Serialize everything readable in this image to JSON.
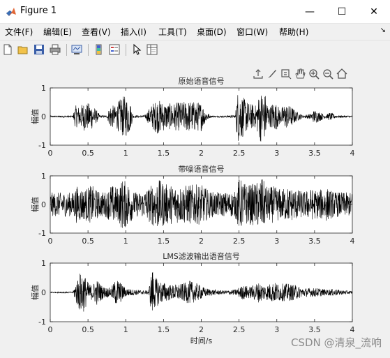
{
  "window": {
    "title": "Figure 1",
    "minimize": "—",
    "maximize": "☐",
    "close": "✕"
  },
  "menu": [
    "文件(F)",
    "编辑(E)",
    "查看(V)",
    "插入(I)",
    "工具(T)",
    "桌面(D)",
    "窗口(W)",
    "帮助(H)"
  ],
  "menu_arrow": "↘",
  "toolbar": [
    "new-figure-icon",
    "open-file-icon",
    "save-icon",
    "print-icon",
    "link-plot-icon",
    "colorbar-icon",
    "legend-icon",
    "pointer-icon",
    "property-inspector-icon"
  ],
  "axes_toolbar": [
    "export-icon",
    "brush-icon",
    "data-tip-icon",
    "pan-icon",
    "zoom-in-icon",
    "zoom-out-icon",
    "home-icon"
  ],
  "watermark": "CSDN @清泉_流响",
  "chart_data": [
    {
      "type": "line",
      "title": "原始语音信号",
      "xlabel": "",
      "ylabel": "幅值",
      "xlim": [
        0,
        4
      ],
      "ylim": [
        -1,
        1
      ],
      "xticks": [
        "0",
        "0.5",
        "1",
        "1.5",
        "2",
        "2.5",
        "3",
        "3.5",
        "4"
      ],
      "yticks": [
        "1",
        "0",
        "-1"
      ],
      "envelope": {
        "x": [
          0,
          0.3,
          0.33,
          0.38,
          0.45,
          0.55,
          0.62,
          0.66,
          0.75,
          0.8,
          0.85,
          0.88,
          0.95,
          1.0,
          1.05,
          1.1,
          1.15,
          1.25,
          1.35,
          1.42,
          1.55,
          1.7,
          1.85,
          2.0,
          2.05,
          2.12,
          2.3,
          2.45,
          2.48,
          2.52,
          2.58,
          2.65,
          2.72,
          2.78,
          2.85,
          2.9,
          2.95,
          3.0,
          3.05,
          3.1,
          3.2,
          3.25,
          3.35,
          3.45,
          3.5,
          3.65,
          3.7,
          3.8,
          4.0
        ],
        "amp": [
          0.03,
          0.03,
          0.4,
          0.35,
          0.5,
          0.45,
          0.2,
          0.04,
          0.04,
          0.45,
          0.35,
          0.45,
          0.7,
          0.72,
          0.6,
          0.04,
          0.04,
          0.04,
          0.45,
          0.6,
          0.45,
          0.5,
          0.55,
          0.5,
          0.25,
          0.03,
          0.03,
          0.05,
          0.9,
          0.85,
          0.6,
          0.45,
          0.4,
          0.9,
          0.8,
          0.3,
          0.55,
          0.45,
          0.25,
          0.45,
          0.35,
          0.2,
          0.04,
          0.1,
          0.25,
          0.05,
          0.15,
          0.04,
          0.03
        ]
      }
    },
    {
      "type": "line",
      "title": "带噪语音信号",
      "xlabel": "",
      "ylabel": "幅值",
      "xlim": [
        0,
        4
      ],
      "ylim": [
        -1,
        1
      ],
      "xticks": [
        "0",
        "0.5",
        "1",
        "1.5",
        "2",
        "2.5",
        "3",
        "3.5",
        "4"
      ],
      "yticks": [
        "1",
        "0",
        "-1"
      ],
      "envelope": {
        "x": [
          0,
          0.3,
          0.35,
          0.45,
          0.55,
          0.62,
          0.66,
          0.75,
          0.8,
          0.9,
          0.95,
          1.05,
          1.1,
          1.2,
          1.3,
          1.42,
          1.55,
          1.7,
          1.85,
          2.0,
          2.05,
          2.12,
          2.3,
          2.45,
          2.5,
          2.55,
          2.62,
          2.72,
          2.8,
          2.88,
          2.95,
          3.05,
          3.15,
          3.25,
          3.35,
          3.45,
          3.55,
          3.65,
          3.75,
          3.9,
          4.0
        ],
        "amp": [
          0.42,
          0.42,
          0.65,
          0.55,
          0.68,
          0.5,
          0.45,
          0.45,
          0.7,
          0.6,
          0.9,
          0.75,
          0.45,
          0.42,
          0.6,
          0.9,
          0.7,
          0.65,
          0.7,
          0.7,
          0.6,
          0.45,
          0.42,
          0.45,
          0.95,
          0.8,
          0.7,
          0.75,
          0.95,
          0.6,
          0.65,
          0.55,
          0.6,
          0.55,
          0.45,
          0.55,
          0.5,
          0.6,
          0.45,
          0.42,
          0.42
        ]
      }
    },
    {
      "type": "line",
      "title": "LMS滤波输出语音信号",
      "xlabel": "时间/s",
      "ylabel": "幅值",
      "xlim": [
        0,
        4
      ],
      "ylim": [
        -1,
        1
      ],
      "xticks": [
        "0",
        "0.5",
        "1",
        "1.5",
        "2",
        "2.5",
        "3",
        "3.5",
        "4"
      ],
      "yticks": [
        "1",
        "0",
        "-1"
      ],
      "envelope": {
        "x": [
          0,
          0.3,
          0.35,
          0.42,
          0.5,
          0.55,
          0.62,
          0.7,
          0.8,
          0.88,
          0.95,
          1.0,
          1.1,
          1.2,
          1.3,
          1.35,
          1.38,
          1.45,
          1.5,
          1.6,
          1.75,
          1.85,
          1.95,
          2.05,
          2.15,
          2.3,
          2.45,
          2.55,
          2.65,
          2.75,
          2.85,
          2.95,
          3.05,
          3.15,
          3.25,
          3.35,
          3.45,
          3.55,
          3.65,
          3.75,
          3.85,
          4.0
        ],
        "amp": [
          0.02,
          0.02,
          0.45,
          0.8,
          0.35,
          0.25,
          0.45,
          0.2,
          0.15,
          0.5,
          0.3,
          0.15,
          0.1,
          0.08,
          0.05,
          0.85,
          0.55,
          0.4,
          0.35,
          0.25,
          0.3,
          0.4,
          0.3,
          0.15,
          0.1,
          0.06,
          0.1,
          0.25,
          0.2,
          0.35,
          0.25,
          0.35,
          0.3,
          0.3,
          0.25,
          0.15,
          0.15,
          0.15,
          0.1,
          0.12,
          0.08,
          0.05
        ]
      }
    }
  ]
}
